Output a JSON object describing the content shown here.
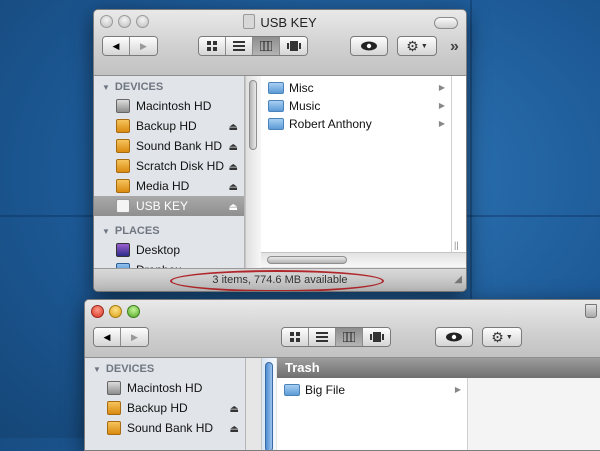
{
  "window1": {
    "title": "USB KEY",
    "sidebar": {
      "sections": [
        {
          "heading": "DEVICES",
          "items": [
            {
              "label": "Macintosh HD",
              "icon": "hard-drive-icon",
              "eject": false,
              "selected": false
            },
            {
              "label": "Backup HD",
              "icon": "external-drive-icon",
              "eject": true,
              "selected": false
            },
            {
              "label": "Sound Bank HD",
              "icon": "external-drive-icon",
              "eject": true,
              "selected": false
            },
            {
              "label": "Scratch Disk HD",
              "icon": "external-drive-icon",
              "eject": true,
              "selected": false
            },
            {
              "label": "Media HD",
              "icon": "external-drive-icon",
              "eject": true,
              "selected": false
            },
            {
              "label": "USB KEY",
              "icon": "usb-drive-icon",
              "eject": true,
              "selected": true
            }
          ]
        },
        {
          "heading": "PLACES",
          "items": [
            {
              "label": "Desktop",
              "icon": "desktop-icon"
            },
            {
              "label": "Dropbox",
              "icon": "dropbox-folder-icon"
            }
          ]
        }
      ]
    },
    "files": [
      "Misc",
      "Music",
      "Robert Anthony"
    ],
    "status": "3 items, 774.6 MB available"
  },
  "window2": {
    "column_header": "Trash",
    "sidebar": {
      "heading": "DEVICES",
      "items": [
        {
          "label": "Macintosh HD",
          "icon": "hard-drive-icon",
          "eject": false
        },
        {
          "label": "Backup HD",
          "icon": "external-drive-icon",
          "eject": true
        },
        {
          "label": "Sound Bank HD",
          "icon": "external-drive-icon",
          "eject": true
        }
      ]
    },
    "files": [
      "Big File"
    ]
  },
  "glyphs": {
    "eject": "⏏",
    "back": "◀",
    "forward": "▶",
    "arrow": "▶",
    "disclosure": "▼",
    "more": "»"
  },
  "colors": {
    "annotation_oval": "#b0262a",
    "selection": "#9a9a9a",
    "desktop": "#1d5a97"
  }
}
